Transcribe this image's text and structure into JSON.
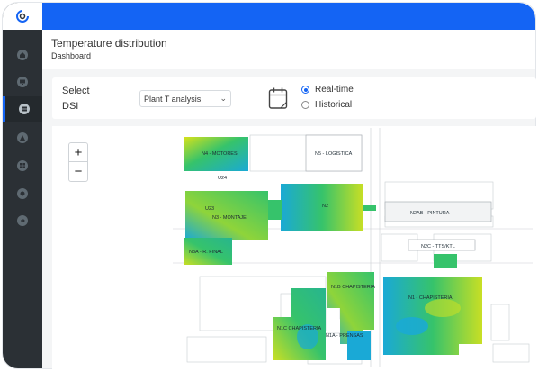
{
  "header": {
    "title": "Temperature distribution",
    "breadcrumb": "Dashboard"
  },
  "sidebar": {
    "items": [
      {
        "icon": "home-icon"
      },
      {
        "icon": "monitor-icon"
      },
      {
        "icon": "table-icon",
        "active": true
      },
      {
        "icon": "warning-icon"
      },
      {
        "icon": "grid-icon"
      },
      {
        "icon": "settings-icon"
      },
      {
        "icon": "logout-icon"
      }
    ]
  },
  "filters": {
    "select_label_line1": "Select",
    "select_label_line2": "DSI",
    "dsi_select_value": "Plant T analysis",
    "radio_realtime": "Real-time",
    "radio_historical": "Historical",
    "selected_mode": "Real-time"
  },
  "map": {
    "zoom_in": "+",
    "zoom_out": "−",
    "buildings": {
      "n4": "N4 - MOTORES",
      "n5": "N5 - LOGISTICA",
      "u24": "U24",
      "u23": "U23",
      "n3": "N3 - MONTAJE",
      "n2": "N2",
      "n2ab": "N2AB - PINTURA",
      "n2c": "N2C - TTS/KTL",
      "n3a": "N3A - R. FINAL",
      "n1b": "N1B CHAPISTERIA",
      "n1": "N1 - CHAPISTERIA",
      "n1c": "N1C CHAPISTERIA",
      "n1a": "N1A - PRENSAS"
    }
  },
  "colors": {
    "accent": "#1464f4",
    "sidebar": "#2b3035",
    "heat_low": "#1aa9d6",
    "heat_mid": "#36c36b",
    "heat_high": "#d8e21a"
  }
}
